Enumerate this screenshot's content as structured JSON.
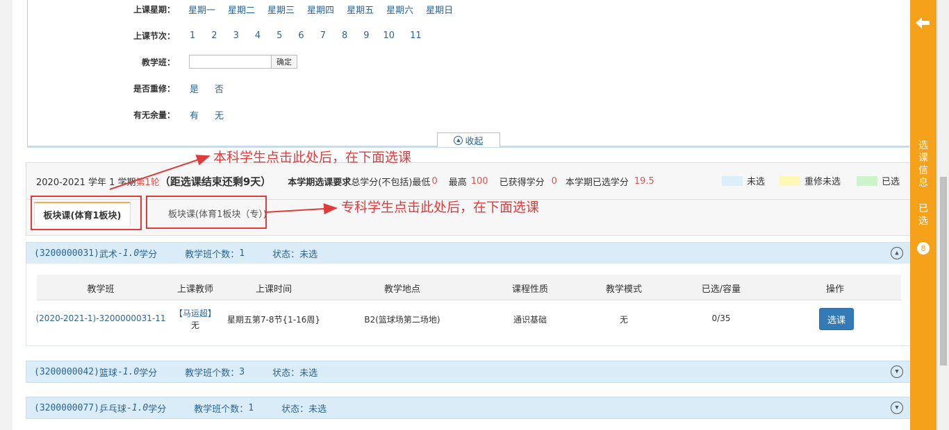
{
  "filters": {
    "weekday": {
      "label": "上课星期：",
      "options": [
        "星期一",
        "星期二",
        "星期三",
        "星期四",
        "星期五",
        "星期六",
        "星期日"
      ]
    },
    "period": {
      "label": "上课节次：",
      "options": [
        "1",
        "2",
        "3",
        "4",
        "5",
        "6",
        "7",
        "8",
        "9",
        "10",
        "11"
      ]
    },
    "class": {
      "label": "教学班：",
      "value": "",
      "button": "确定"
    },
    "retake": {
      "label": "是否重修：",
      "options": [
        "是",
        "否"
      ]
    },
    "remaining": {
      "label": "有无余量：",
      "options": [
        "有",
        "无"
      ]
    },
    "collapse_label": "收起"
  },
  "term": {
    "year": "2020-2021 学年 1 学期",
    "round": "第1轮",
    "countdown": "（距选课结束还剩9天）",
    "req_label": "本学期选课要求",
    "min_label": "总学分(不包括)最低",
    "min_value": "0",
    "max_label": "最高",
    "max_value": "100",
    "earned_label": "已获得学分",
    "earned_value": "0",
    "selected_label": "本学期已选学分",
    "selected_value": "19.5"
  },
  "legend": [
    {
      "label": "未选",
      "color": "#dbeef9"
    },
    {
      "label": "重修未选",
      "color": "#fdf7b8"
    },
    {
      "label": "已选",
      "color": "#c9f5c9"
    }
  ],
  "tabs": [
    "板块课(体育1板块)",
    "板块课(体育1板块（专）)"
  ],
  "annotations": {
    "top": "本科学生点击此处后，在下面选课",
    "middle": "专科学生点击此处后，在下面选课"
  },
  "courses": [
    {
      "code": "(3200000031)",
      "name": "武术",
      "credit_prefix": " - ",
      "credit": "1.0",
      "credit_unit": " 学分",
      "count_label": "教学班个数：",
      "count": "1",
      "status_label": "状态：",
      "status": "未选"
    },
    {
      "code": "(3200000042)",
      "name": "篮球",
      "credit_prefix": " - ",
      "credit": "1.0",
      "credit_unit": " 学分",
      "count_label": "教学班个数：",
      "count": "3",
      "status_label": "状态：",
      "status": "未选"
    },
    {
      "code": "(3200000077)",
      "name": "乒乓球",
      "credit_prefix": " - ",
      "credit": "1.0",
      "credit_unit": " 学分",
      "count_label": "教学班个数：",
      "count": "1",
      "status_label": "状态：",
      "status": "未选"
    }
  ],
  "table": {
    "headers": [
      "教学班",
      "上课教师",
      "上课时间",
      "教学地点",
      "课程性质",
      "教学模式",
      "已选/容量",
      "操作"
    ],
    "row": {
      "class": "(2020-2021-1)-3200000031-11",
      "teacher": "【马运超】",
      "teacher_title": "无",
      "time": "星期五第7-8节{1-16周}",
      "place": "B2(篮球场第二场地)",
      "nature": "通识基础",
      "mode": "无",
      "capacity": "0/35",
      "action": "选课"
    }
  },
  "sidebar": {
    "arrow": "🡐",
    "title": [
      "选",
      "课",
      "信",
      "息"
    ],
    "selected": [
      "已",
      "选"
    ],
    "badge": "8"
  }
}
